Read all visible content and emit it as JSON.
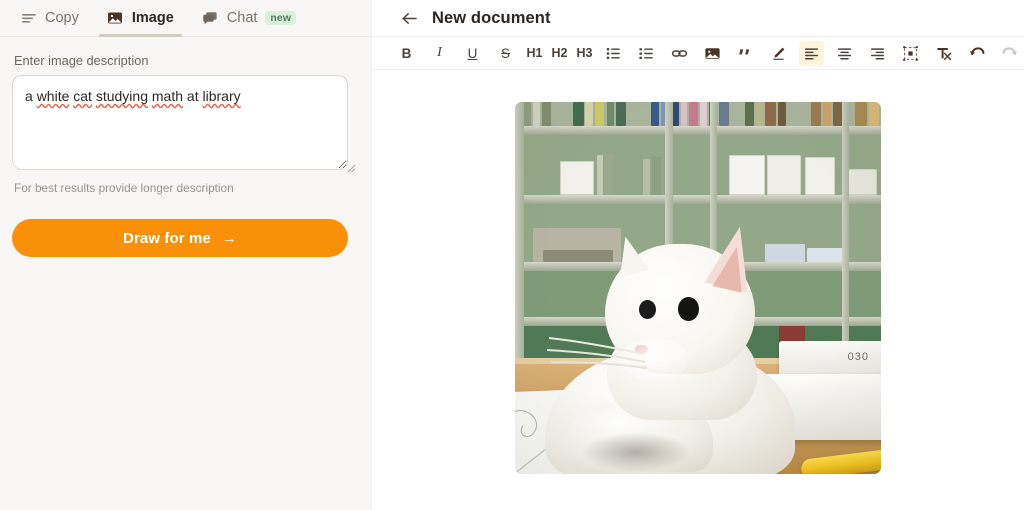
{
  "sidebar": {
    "tabs": [
      {
        "label": "Copy",
        "icon": "lines-icon",
        "active": false,
        "badge": null
      },
      {
        "label": "Image",
        "icon": "picture-icon",
        "active": true,
        "badge": null
      },
      {
        "label": "Chat",
        "icon": "chat-bubble-icon",
        "active": false,
        "badge": "new"
      }
    ],
    "field_label": "Enter image description",
    "description_value": "a white cat studying math at library",
    "description_tokens": [
      {
        "text": "a",
        "misspelled": false
      },
      {
        "text": "white",
        "misspelled": true
      },
      {
        "text": "cat",
        "misspelled": true
      },
      {
        "text": "studying",
        "misspelled": true
      },
      {
        "text": "math",
        "misspelled": true
      },
      {
        "text": "at",
        "misspelled": false
      },
      {
        "text": "library",
        "misspelled": true
      }
    ],
    "description_placeholder": "Enter image description",
    "hint": "For best results provide longer description",
    "submit_label": "Draw for me",
    "submit_arrow": "→",
    "accent_color": "#f99007",
    "badge_color": "#d9f0dc"
  },
  "document": {
    "back_icon": "arrow-left-icon",
    "title": "New document",
    "toolbar": {
      "bold": "B",
      "italic": "I",
      "underline": "U",
      "strikethrough": "S",
      "h1": "H1",
      "h2": "H2",
      "h3": "H3",
      "bullet_list": "bullet-list-icon",
      "numbered_list": "numbered-list-icon",
      "link": "link-icon",
      "image": "image-icon",
      "quote": "quote-icon",
      "highlight": "highlighter-icon",
      "align_left": "align-left-icon",
      "align_center": "align-center-icon",
      "align_right": "align-right-icon",
      "resize": "resize-handles-icon",
      "clear_format": "clear-formatting-icon",
      "undo": "undo-icon",
      "redo": "redo-icon",
      "active_button": "align-left-icon",
      "disabled_buttons": [
        "redo-icon"
      ],
      "active_highlight_color": "#fdf4d9"
    },
    "generated_image": {
      "alt": "a white cat studying math at library",
      "scene": "white cat resting on a wooden desk with papers and white books in front of green library bookshelves"
    }
  }
}
